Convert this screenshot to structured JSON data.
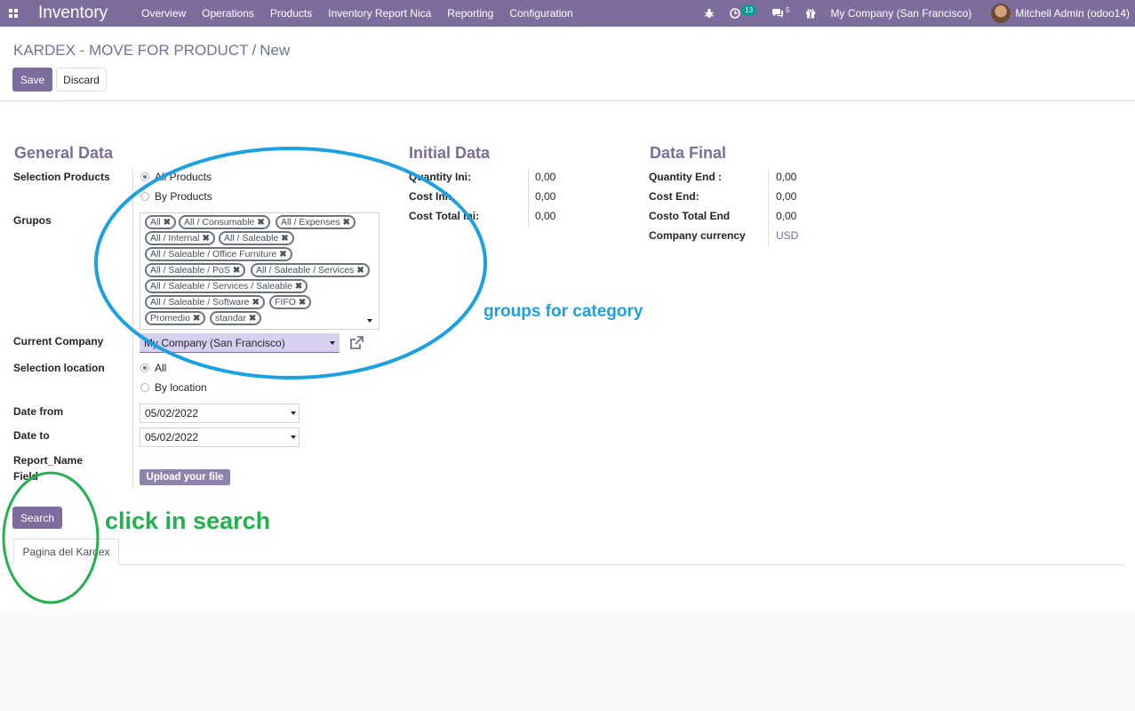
{
  "navbar": {
    "app_title": "Inventory",
    "menu": [
      "Overview",
      "Operations",
      "Products",
      "Inventory Report Nica",
      "Reporting",
      "Configuration"
    ],
    "activity_count": "13",
    "message_count": "5",
    "company": "My Company (San Francisco)",
    "user": "Mitchell Admin (odoo14)"
  },
  "breadcrumb": {
    "parent": "KARDEX - MOVE FOR PRODUCT",
    "separator": "/",
    "current": "New"
  },
  "buttons": {
    "save": "Save",
    "discard": "Discard",
    "upload": "Upload your file",
    "search": "Search"
  },
  "general": {
    "title": "General Data",
    "selection_products_label": "Selection Products",
    "selection_products_options": [
      "All Products",
      "By Products"
    ],
    "selection_products_value": "All Products",
    "grupos_label": "Grupos",
    "grupos_tags": [
      "All",
      "All / Consumable",
      "All / Expenses",
      "All / Internal",
      "All / Saleable",
      "All / Saleable / Office Furniture",
      "All / Saleable / PoS",
      "All / Saleable / Services",
      "All / Saleable / Services / Saleable",
      "All / Saleable / Software",
      "FIFO",
      "Promedio",
      "standar"
    ],
    "current_company_label": "Current Company",
    "current_company_value": "My Company (San Francisco)",
    "selection_location_label": "Selection location",
    "selection_location_options": [
      "All",
      "By location"
    ],
    "selection_location_value": "All",
    "date_from_label": "Date from",
    "date_from_value": "05/02/2022",
    "date_to_label": "Date to",
    "date_to_value": "05/02/2022",
    "report_name_label_1": "Report_Name",
    "report_name_label_2": "Field"
  },
  "initial": {
    "title": "Initial Data",
    "rows": [
      {
        "label": "Quantity Ini:",
        "value": "0,00"
      },
      {
        "label": "Cost Ini:",
        "value": "0,00"
      },
      {
        "label": "Cost Total Ini:",
        "value": "0,00"
      }
    ]
  },
  "final": {
    "title": "Data Final",
    "rows": [
      {
        "label": "Quantity End :",
        "value": "0,00"
      },
      {
        "label": "Cost End:",
        "value": "0,00"
      },
      {
        "label": "Costo Total End",
        "value": "0,00"
      },
      {
        "label": "Company currency",
        "value": "USD"
      }
    ]
  },
  "tabs": [
    "Pagina del Kardex"
  ],
  "annotations": {
    "groups": "groups for category",
    "search": "click in search"
  },
  "colors": {
    "primary": "#7c6d9c",
    "annotation_blue": "#1ba1e2",
    "annotation_green": "#22b14c",
    "accent_badge": "#01a191"
  }
}
